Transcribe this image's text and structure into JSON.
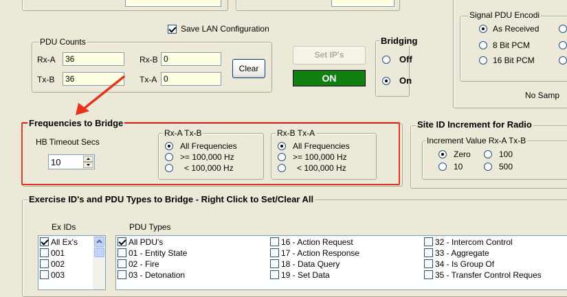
{
  "lan": {
    "save_config_label": "Save LAN Configuration",
    "save_config_checked": true
  },
  "pdu_counts": {
    "legend": "PDU Counts",
    "rxa_label": "Rx-A",
    "rxa_value": "36",
    "rxb_label": "Rx-B",
    "rxb_value": "0",
    "txb_label": "Tx-B",
    "txb_value": "36",
    "txa_label": "Tx-A",
    "txa_value": "0",
    "clear_label": "Clear"
  },
  "controls": {
    "set_ips_label": "Set IP's",
    "on_label": "ON"
  },
  "bridging": {
    "legend": "Bridging",
    "off_label": "Off",
    "on_label": "On",
    "selected": "On"
  },
  "signal_pdu": {
    "legend": "Signal PDU Encodi",
    "options": [
      "As Received",
      "8 Bit PCM",
      "16 Bit PCM"
    ],
    "selected": "As Received",
    "no_samples_text": "No Samp"
  },
  "frequencies": {
    "legend": "Frequencies to Bridge",
    "hb_timeout_label": "HB Timeout Secs",
    "hb_timeout_value": "10",
    "rxa_txb": {
      "legend": "Rx-A  Tx-B",
      "options": [
        "All Frequencies",
        ">= 100,000 Hz",
        "< 100,000 Hz"
      ],
      "selected": "All Frequencies"
    },
    "rxb_txa": {
      "legend": "Rx-B  Tx-A",
      "options": [
        "All Frequencies",
        ">= 100,000 Hz",
        "< 100,000 Hz"
      ],
      "selected": "All Frequencies"
    }
  },
  "site_id": {
    "legend": "Site ID Increment for Radio",
    "increment_legend": "Increment Value Rx-A  Tx-B",
    "options": [
      "Zero",
      "100",
      "10",
      "500"
    ],
    "selected": "Zero"
  },
  "exercise": {
    "legend": "Exercise ID's and PDU Types to Bridge  -  Right Click to Set/Clear All",
    "ex_ids_header": "Ex IDs",
    "pdu_types_header": "PDU Types",
    "ex_ids": [
      {
        "label": "All Ex's",
        "checked": true
      },
      {
        "label": "001",
        "checked": false
      },
      {
        "label": "002",
        "checked": false
      },
      {
        "label": "003",
        "checked": false
      }
    ],
    "pdu_col1": [
      {
        "label": "All PDU's",
        "checked": true
      },
      {
        "label": "01 - Entity State",
        "checked": false
      },
      {
        "label": "02 - Fire",
        "checked": false
      },
      {
        "label": "03 - Detonation",
        "checked": false
      }
    ],
    "pdu_col2": [
      {
        "label": "16 - Action Request",
        "checked": false
      },
      {
        "label": "17 - Action Response",
        "checked": false
      },
      {
        "label": "18 - Data Query",
        "checked": false
      },
      {
        "label": "19 - Set Data",
        "checked": false
      }
    ],
    "pdu_col3": [
      {
        "label": "32 - Intercom Control",
        "checked": false
      },
      {
        "label": "33 - Aggregate",
        "checked": false
      },
      {
        "label": "34 - Is Group Of",
        "checked": false
      },
      {
        "label": "35 - Transfer Control Reques",
        "checked": false
      }
    ]
  },
  "colors": {
    "annotation": "#e8321c",
    "on_button": "#108010",
    "field_bg": "#ffffe1"
  }
}
